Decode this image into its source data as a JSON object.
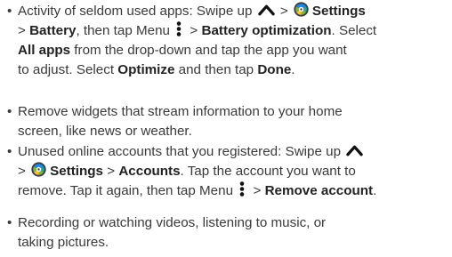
{
  "bullet": "•",
  "items": [
    {
      "lines": [
        [
          "Activity of seldom used apps: Swipe up ",
          "{chev}",
          " > ",
          "{gear}",
          "**Settings**"
        ],
        [
          "> ",
          "**Battery**",
          ", then tap Menu ",
          "{menu}",
          " > ",
          "**Battery optimization**",
          ". Select"
        ],
        [
          "**All apps**",
          " from the drop-down and tap the app you want"
        ],
        [
          "to adjust. Select ",
          "**Optimize**",
          " and then tap ",
          "**Done**",
          "."
        ]
      ]
    },
    {
      "lines": [
        [
          "Remove widgets that stream information to your home"
        ],
        [
          "screen, like news or weather."
        ]
      ]
    },
    {
      "lines": [
        [
          "Unused online accounts that you registered: Swipe up ",
          "{chev}"
        ],
        [
          "> ",
          "{gear}",
          "**Settings**",
          " > ",
          "**Accounts**",
          ". Tap the account you want to"
        ],
        [
          "remove. Tap it again, then tap Menu ",
          "{menu}",
          " > ",
          "**Remove account**",
          "."
        ]
      ]
    },
    {
      "lines": [
        [
          "Recording or watching videos, listening to music, or"
        ],
        [
          "taking pictures."
        ]
      ]
    }
  ],
  "icons": {
    "chev": "chevron-up-icon",
    "gear": "settings-gear-icon",
    "menu": "menu-vertical-dots-icon"
  },
  "colors": {
    "text": "#3a3a3a",
    "gear_blue": "#1e88e5",
    "gear_teal": "#26a69a",
    "gear_green": "#7cb342",
    "gear_yellow": "#fbc02d"
  }
}
